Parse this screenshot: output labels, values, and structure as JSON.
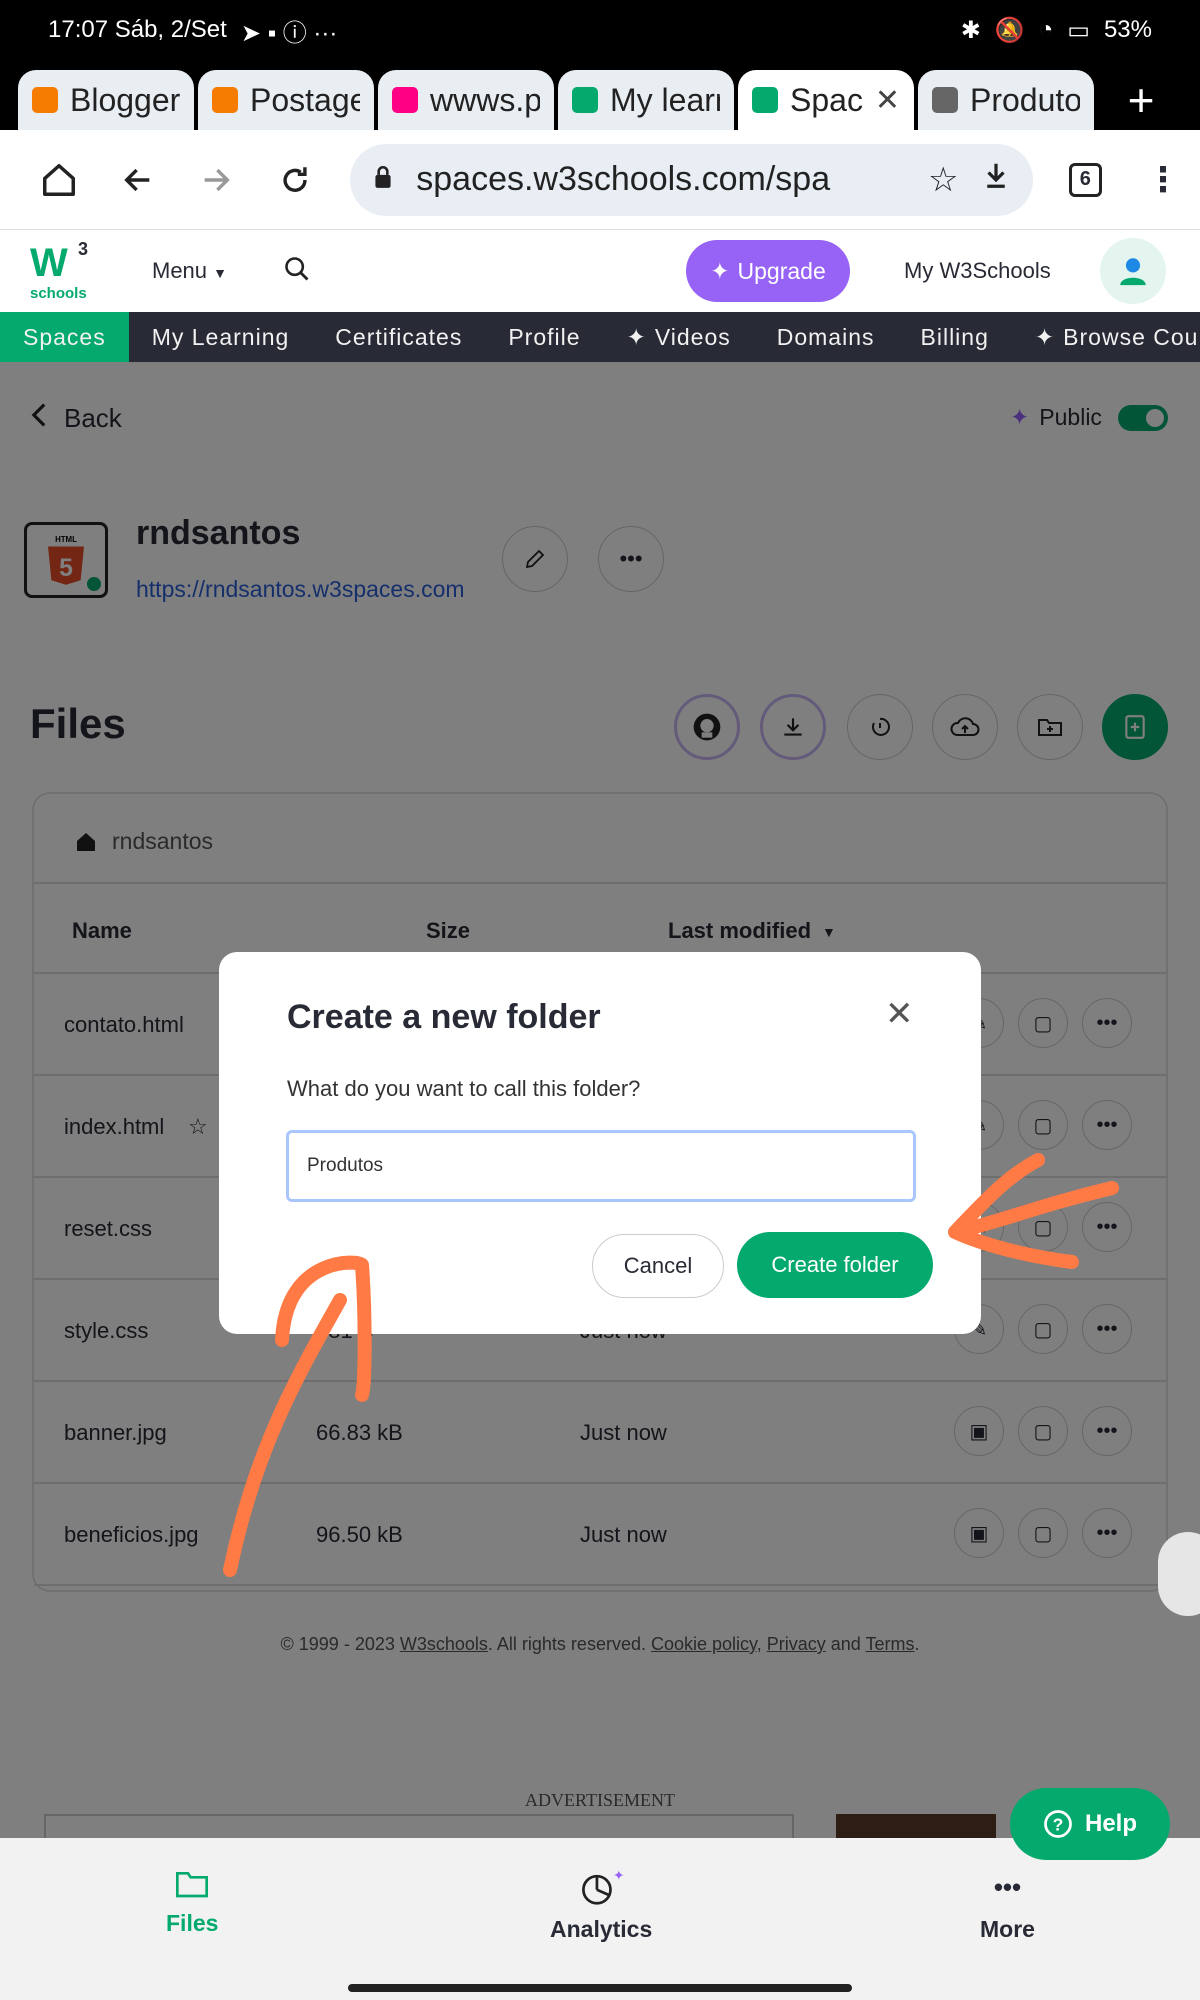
{
  "status_bar": {
    "time": "17:07 Sáb, 2/Set",
    "battery": "53%"
  },
  "browser": {
    "tabs": [
      {
        "label": "Blogger:",
        "favicon": "blogger-icon",
        "color": "#f57c00"
      },
      {
        "label": "Postage",
        "favicon": "blogger-icon",
        "color": "#f57c00"
      },
      {
        "label": "wwws.p",
        "favicon": "flickr-icon",
        "color": "#ff0084"
      },
      {
        "label": "My learn",
        "favicon": "w3schools-icon",
        "color": "#04aa6d"
      },
      {
        "label": "Spac",
        "favicon": "w3schools-icon",
        "color": "#04aa6d",
        "active": true
      },
      {
        "label": "Produtos",
        "favicon": "globe-icon",
        "color": "#666666"
      }
    ],
    "url": "spaces.w3schools.com/spa",
    "tab_count": "6"
  },
  "site_header": {
    "logo_w": "W",
    "logo_sup": "3",
    "logo_text": "schools",
    "menu_label": "Menu",
    "upgrade_label": "Upgrade",
    "my_w3schools_label": "My W3Schools"
  },
  "nav": {
    "items": [
      "Spaces",
      "My Learning",
      "Certificates",
      "Profile",
      "Videos",
      "Domains",
      "Billing",
      "Browse Cour"
    ]
  },
  "space": {
    "back_label": "Back",
    "public_label": "Public",
    "name": "rndsantos",
    "url": "https://rndsantos.w3spaces.com",
    "badge_text": "HTML"
  },
  "files": {
    "title": "Files",
    "breadcrumb": "rndsantos",
    "columns": {
      "name": "Name",
      "size": "Size",
      "modified": "Last modified"
    },
    "rows": [
      {
        "name": "contato.html",
        "size": "",
        "modified": ""
      },
      {
        "name": "index.html",
        "size": "",
        "modified": ""
      },
      {
        "name": "reset.css",
        "size": "",
        "modified": ""
      },
      {
        "name": "style.css",
        "size": "581 B",
        "modified": "Just now"
      },
      {
        "name": "banner.jpg",
        "size": "66.83 kB",
        "modified": "Just now"
      },
      {
        "name": "beneficios.jpg",
        "size": "96.50 kB",
        "modified": "Just now"
      }
    ]
  },
  "footer": {
    "prefix": "© 1999 - 2023 ",
    "brand": "W3schools",
    "middle": ". All rights reserved. ",
    "cookie": "Cookie policy",
    "sep": ", ",
    "privacy": "Privacy",
    "and": " and ",
    "terms": "Terms",
    "end": "."
  },
  "ad_label": "ADVERTISEMENT",
  "help_label": "Help",
  "bottom_nav": {
    "files": "Files",
    "analytics": "Analytics",
    "more": "More"
  },
  "modal": {
    "title": "Create a new folder",
    "question": "What do you want to call this folder?",
    "input_value": "Produtos",
    "cancel_label": "Cancel",
    "create_label": "Create folder"
  },
  "colors": {
    "brand_green": "#04aa6d",
    "upgrade_purple": "#9763f6",
    "annotation_orange": "#ff7a45",
    "nav_dark": "#282a35"
  }
}
